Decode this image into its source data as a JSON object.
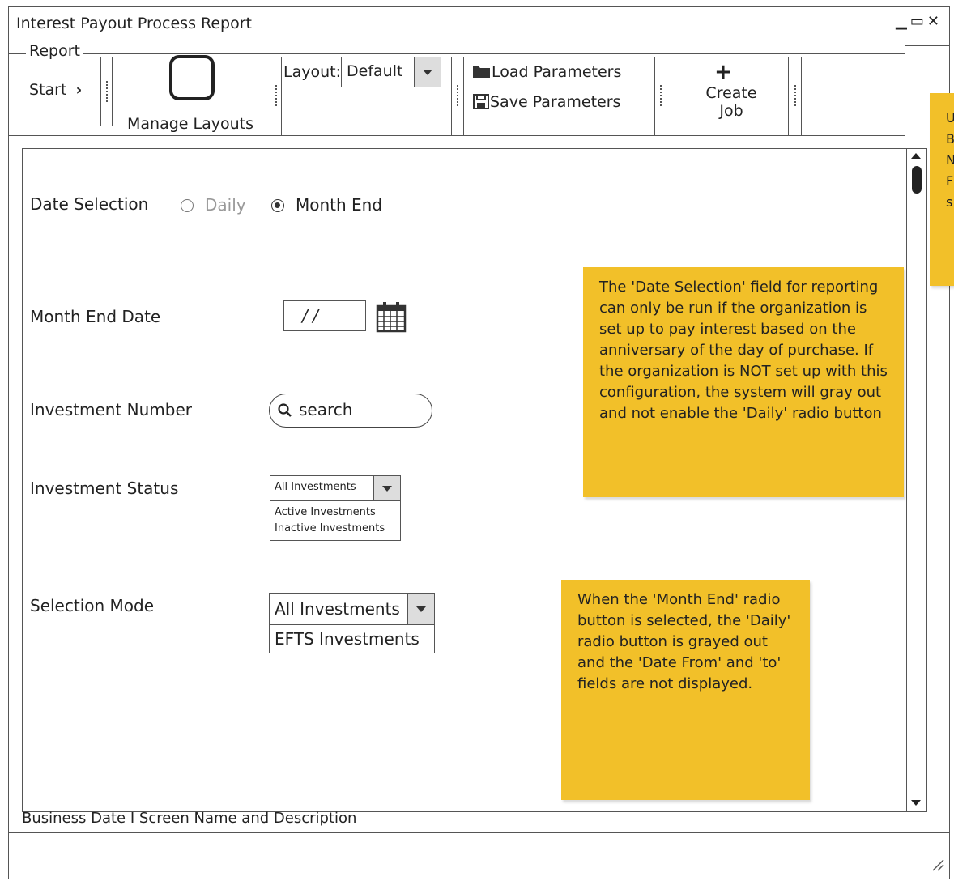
{
  "window": {
    "title": "Interest Payout Process Report",
    "controls": "▁▭✕"
  },
  "toolbar": {
    "group_label": "Report",
    "start_label": "Start",
    "manage_layouts_label": "Manage Layouts",
    "layout_label": "Layout:",
    "layout_value": "Default",
    "load_parameters_label": "Load Parameters",
    "save_parameters_label": "Save Parameters",
    "create_job_label_1": "Create",
    "create_job_label_2": "Job"
  },
  "form": {
    "date_selection": {
      "label": "Date Selection",
      "options": [
        "Daily",
        "Month End"
      ],
      "selected": "Month End"
    },
    "month_end_date": {
      "label": "Month End Date",
      "value": "/ /"
    },
    "investment_number": {
      "label": "Investment Number",
      "placeholder": "search"
    },
    "investment_status": {
      "label": "Investment Status",
      "selected": "All Investments",
      "options": [
        "Active Investments",
        "Inactive Investments"
      ]
    },
    "selection_mode": {
      "label": "Selection Mode",
      "selected": "All Investments",
      "options": [
        "EFTS Investments"
      ]
    }
  },
  "notes": {
    "date_selection_note": "The 'Date Selection' field for reporting can only be run if the organization is set up to pay interest based on the anniversary of the day of purchase. If the organization is NOT set up with this configuration, the system will gray out and not enable the 'Daily' radio button",
    "month_end_note": "When the 'Month End' radio button is selected, the 'Daily' radio button is grayed out and the 'Date From'  and 'to' fields are not displayed.",
    "side_note_fragment": "U\nB\nN\nF\ns"
  },
  "status_bar": {
    "text": "Business Date I Screen Name and Description"
  },
  "colors": {
    "note_yellow": "#f2c029",
    "border": "#555555"
  }
}
